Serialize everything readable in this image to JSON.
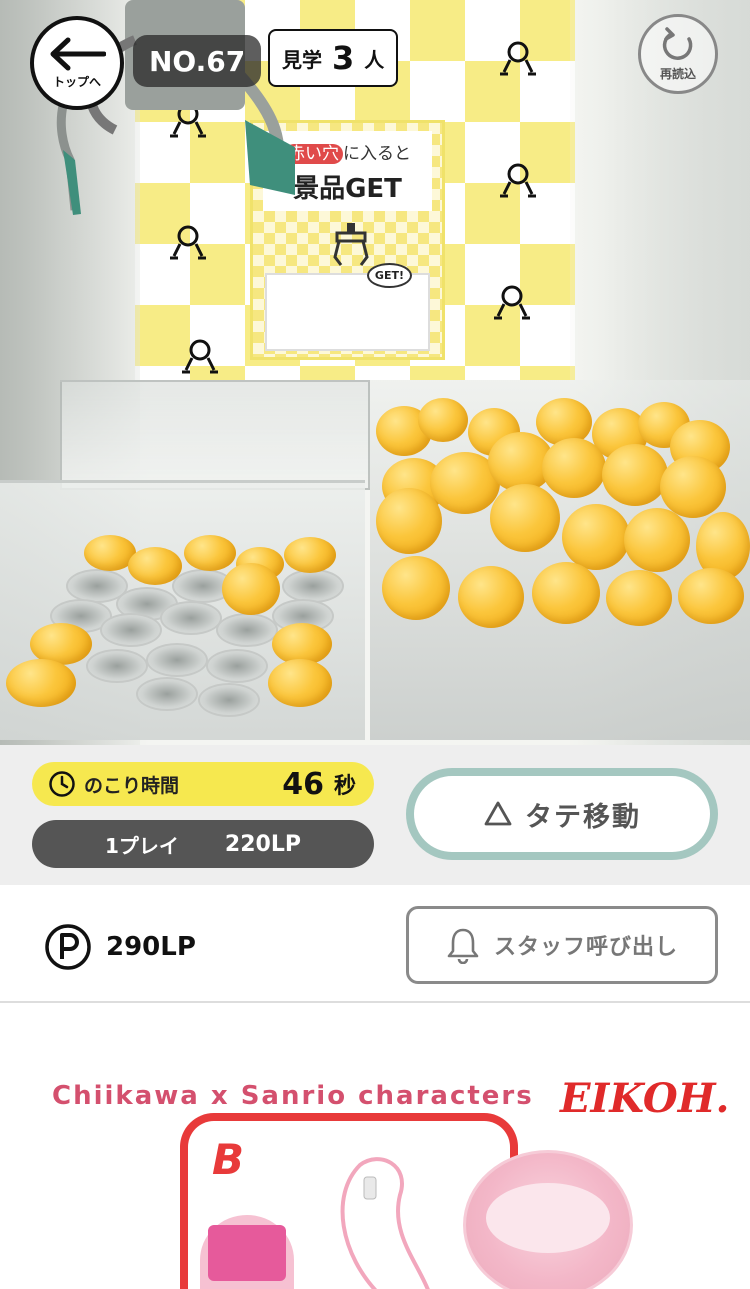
{
  "header": {
    "back": {
      "label": "トップへ",
      "icon": "left-arrow-icon"
    },
    "machine_number": "NO.67",
    "viewers": {
      "label": "見学",
      "count": "3",
      "unit": "人"
    },
    "reload": {
      "label": "再読込",
      "icon": "reload-icon"
    }
  },
  "camera": {
    "poster": {
      "line1_highlight": "赤い穴",
      "line1_rest": "に入ると",
      "line2": "景品GET",
      "badge": "GET!"
    }
  },
  "controls": {
    "timer": {
      "icon": "clock-icon",
      "label": "のこり時間",
      "value": "46",
      "unit": "秒"
    },
    "price": {
      "label": "1プレイ",
      "value": "220LP"
    },
    "move_button": {
      "icon": "triangle-icon",
      "label": "タテ移動"
    }
  },
  "account": {
    "points": {
      "icon": "points-p-icon",
      "value": "290LP"
    },
    "staff_button": {
      "icon": "bell-icon",
      "label": "スタッフ呼び出し"
    }
  },
  "banner": {
    "title": "Chiikawa x Sanrio characters",
    "brand": "EIKOH.",
    "prize_letter": "B"
  },
  "colors": {
    "timer_bg": "#f6e84f",
    "price_bg": "#555555",
    "move_ring": "#a4c7c0",
    "banner_red": "#e83a3a"
  }
}
